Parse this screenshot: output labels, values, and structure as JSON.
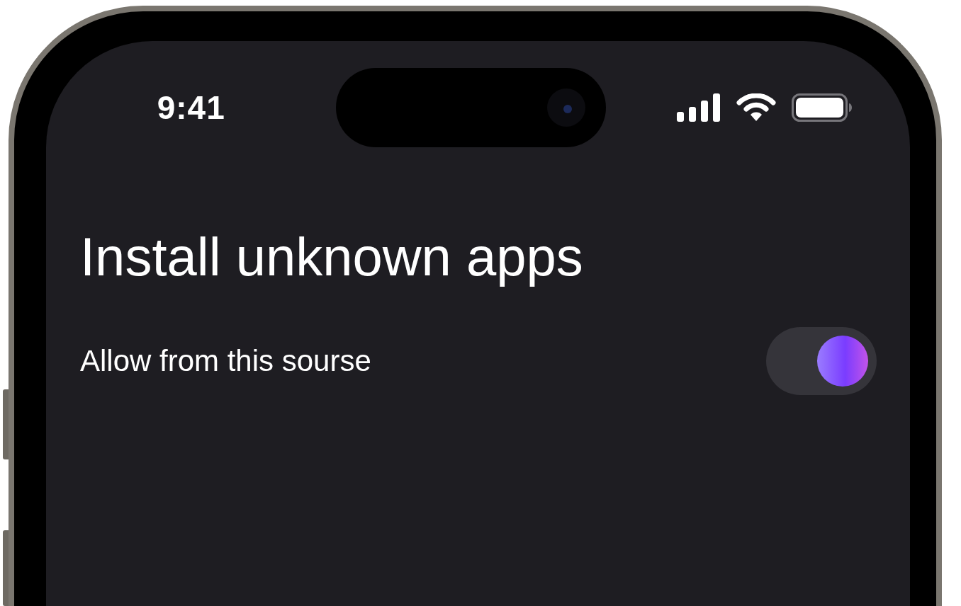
{
  "status_bar": {
    "time": "9:41"
  },
  "title": "Install unknown apps",
  "settings": [
    {
      "label": "Allow from this sourse",
      "on": true
    }
  ]
}
